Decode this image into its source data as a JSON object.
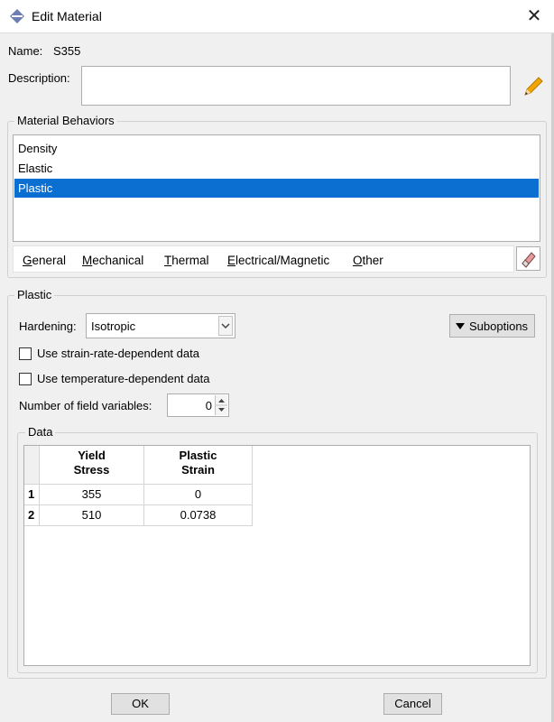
{
  "window": {
    "title": "Edit Material",
    "close_glyph": "✕",
    "icon": "app-diamond-icon"
  },
  "material": {
    "name_label": "Name:",
    "name_value": "S355",
    "description_label": "Description:",
    "description_value": ""
  },
  "behaviors": {
    "group_title": "Material Behaviors",
    "items": [
      "Density",
      "Elastic",
      "Plastic"
    ],
    "selected_index": 2
  },
  "menu": {
    "items": [
      {
        "label": "General",
        "mnemonic": "G"
      },
      {
        "label": "Mechanical",
        "mnemonic": "M"
      },
      {
        "label": "Thermal",
        "mnemonic": "T"
      },
      {
        "label": "Electrical/Magnetic",
        "mnemonic": "E"
      },
      {
        "label": "Other",
        "mnemonic": "O"
      }
    ]
  },
  "plastic": {
    "group_title": "Plastic",
    "hardening_label": "Hardening:",
    "hardening_value": "Isotropic",
    "suboptions_label": "Suboptions",
    "strain_rate_label": "Use strain-rate-dependent data",
    "strain_rate_checked": false,
    "temperature_label": "Use temperature-dependent data",
    "temperature_checked": false,
    "field_vars_label": "Number of field variables:",
    "field_vars_value": "0"
  },
  "data_table": {
    "group_title": "Data",
    "columns": [
      {
        "line1": "Yield",
        "line2": "Stress"
      },
      {
        "line1": "Plastic",
        "line2": "Strain"
      }
    ],
    "rows": [
      {
        "index": "1",
        "cells": [
          "355",
          "0"
        ]
      },
      {
        "index": "2",
        "cells": [
          "510",
          "0.0738"
        ]
      }
    ]
  },
  "footer": {
    "ok_label": "OK",
    "cancel_label": "Cancel"
  },
  "colors": {
    "selection": "#0a6fd1",
    "window_bg": "#f0f0f0",
    "pencil": "#f2a400"
  }
}
